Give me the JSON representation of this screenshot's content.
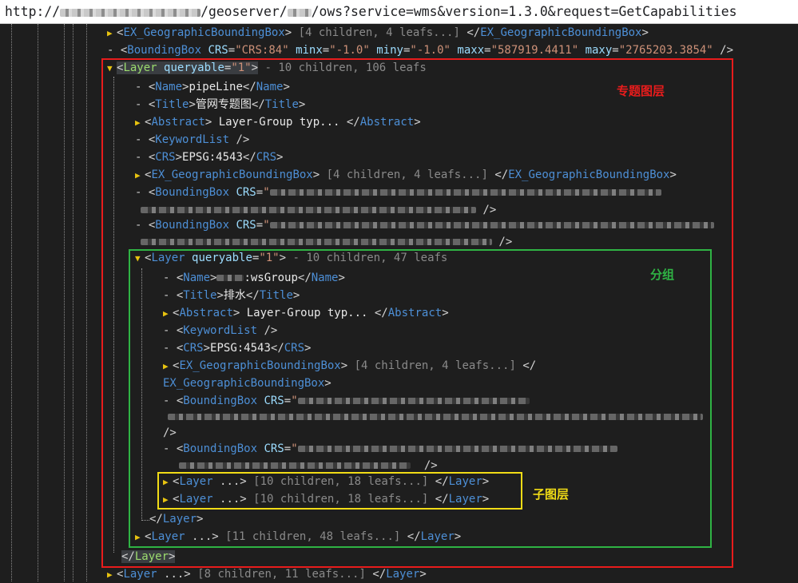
{
  "address_bar": {
    "prefix": "http://",
    "part_geoserver": "/geoserver/",
    "part_query": "/ows?service=wms&version=1.3.0&request=GetCapabilities"
  },
  "annotations": {
    "red": "专题图层",
    "green": "分组",
    "yellow": "子图层"
  },
  "colors": {
    "red_box": "#e81c1c",
    "green_box": "#2fb344",
    "yellow_box": "#f1dc16"
  },
  "xml": {
    "top_bbox": {
      "open": "EX_GeographicBoundingBox",
      "summary": "[4 children, 4 leafs...]",
      "close": "EX_GeographicBoundingBox"
    },
    "top_crs_line": {
      "tag": "BoundingBox",
      "a1": "CRS",
      "v1": "\"CRS:84\"",
      "a2": "minx",
      "v2": "\"-1.0\"",
      "a3": "miny",
      "v3": "\"-1.0\"",
      "a4": "maxx",
      "v4": "\"587919.4411\"",
      "a5": "maxy",
      "v5": "\"2765203.3854\""
    },
    "layer1": {
      "tag": "Layer",
      "attr": "queryable",
      "attr_value": "\"1\"",
      "summary": "- 10 children, 106 leafs",
      "name_tag": "Name",
      "name": "pipeLine",
      "title_tag": "Title",
      "title": "管网专题图",
      "abstract_tag": "Abstract",
      "abstract": "Layer-Group typ...",
      "keyword_tag": "KeywordList",
      "crs_tag": "CRS",
      "crs": "EPSG:4543",
      "ex_tag": "EX_GeographicBoundingBox",
      "ex_summary": "[4 children, 4 leafs...]",
      "bbox_tag": "BoundingBox",
      "bbox_attr": "CRS"
    },
    "layer2": {
      "tag": "Layer",
      "attr": "queryable",
      "attr_value": "\"1\"",
      "summary": "- 10 children, 47 leafs",
      "name_tag": "Name",
      "name": ":wsGroup",
      "title_tag": "Title",
      "title": "排水",
      "abstract_tag": "Abstract",
      "abstract": "Layer-Group typ...",
      "keyword_tag": "KeywordList",
      "crs_tag": "CRS",
      "crs": "EPSG:4543",
      "ex_tag": "EX_GeographicBoundingBox",
      "ex_summary": "[4 children, 4 leafs...]",
      "bbox_tag": "BoundingBox",
      "bbox_attr": "CRS"
    },
    "sublayers": [
      {
        "tag": "Layer",
        "summary": "[10 children, 18 leafs...]"
      },
      {
        "tag": "Layer",
        "summary": "[10 children, 18 leafs...]"
      }
    ],
    "layer3": {
      "tag": "Layer",
      "summary": "[11 children, 48 leafs...]"
    },
    "layer_close": "Layer",
    "layer_last": {
      "tag": "Layer",
      "summary": "[8 children, 11 leafs...]"
    }
  }
}
